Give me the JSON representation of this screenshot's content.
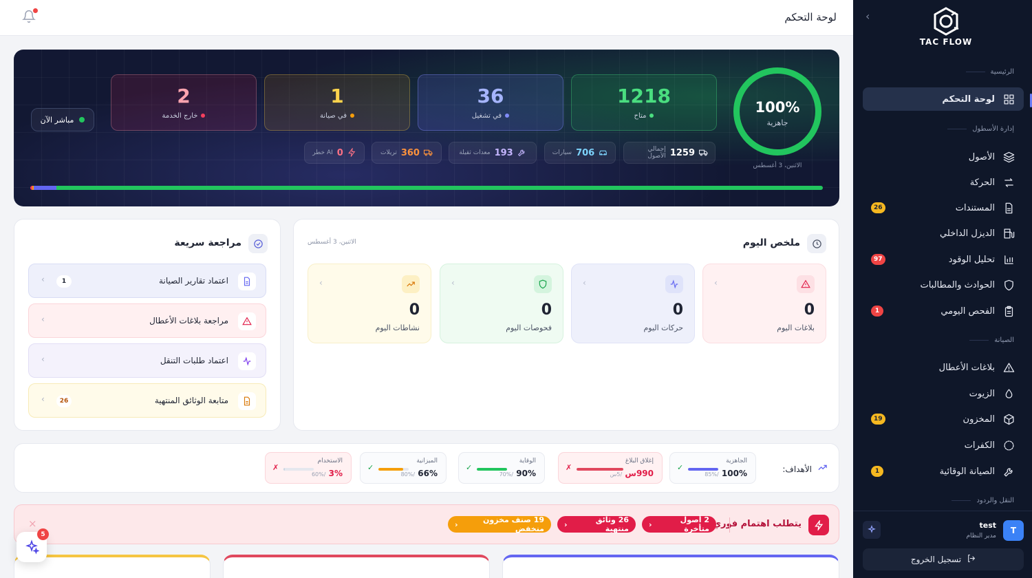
{
  "app": {
    "name": "TAC FLOW"
  },
  "topbar": {
    "title": "لوحة التحكم"
  },
  "sidebar": {
    "sections": {
      "main": "الرئيسية",
      "fleet": "إدارة الأسطول",
      "maintenance": "الصيانة",
      "transport": "النقل والردود"
    },
    "items": [
      {
        "label": "لوحة التحكم",
        "icon": "grid-icon",
        "active": true
      },
      {
        "label": "الأصول",
        "icon": "layers-icon"
      },
      {
        "label": "الحركة",
        "icon": "swap-icon"
      },
      {
        "label": "المستندات",
        "icon": "document-icon",
        "badge": "26"
      },
      {
        "label": "الديزل الداخلي",
        "icon": "fuel-icon"
      },
      {
        "label": "تحليل الوقود",
        "icon": "bar-chart-icon",
        "badge": "97"
      },
      {
        "label": "الحوادث والمطالبات",
        "icon": "shield-icon"
      },
      {
        "label": "الفحص اليومي",
        "icon": "clipboard-icon",
        "badge": "1"
      },
      {
        "label": "بلاغات الأعطال",
        "icon": "warning-icon"
      },
      {
        "label": "الزيوت",
        "icon": "droplet-icon"
      },
      {
        "label": "المخزون",
        "icon": "box-icon",
        "badge": "19"
      },
      {
        "label": "الكفرات",
        "icon": "tire-icon"
      },
      {
        "label": "الصيانة الوقائية",
        "icon": "wrench-icon",
        "badge": "1"
      }
    ],
    "user": {
      "initial": "T",
      "name": "test",
      "role": "مدير النظام"
    },
    "logout": "تسجيل الخروج"
  },
  "hero": {
    "readiness": {
      "value": "100%",
      "label": "جاهزية",
      "date": "الاثنين، 3 أغسطس"
    },
    "live": "مباشر الآن",
    "stats": [
      {
        "value": "1218",
        "label": "متاح",
        "color": "#4ade80"
      },
      {
        "value": "36",
        "label": "في تشغيل",
        "color": "#a5b4fc"
      },
      {
        "value": "1",
        "label": "في صيانة",
        "color": "#fcd34d"
      },
      {
        "value": "2",
        "label": "خارج الخدمة",
        "color": "#fda4af"
      }
    ],
    "chips": [
      {
        "value": "1259",
        "label": "إجمالي الأصول",
        "icon": "truck-icon"
      },
      {
        "value": "706",
        "label": "سيارات",
        "icon": "car-icon"
      },
      {
        "value": "193",
        "label": "معدات ثقيلة",
        "icon": "wrench-icon"
      },
      {
        "value": "360",
        "label": "تريلات",
        "icon": "trailer-icon"
      },
      {
        "value": "0",
        "label": "AI خطر",
        "icon": "bolt-icon"
      }
    ],
    "progress": {
      "available": 96.7,
      "operating": 2.9,
      "maintenance": 0.1,
      "out": 0.2
    }
  },
  "quick_review": {
    "title": "مراجعة سريعة",
    "items": [
      {
        "label": "اعتماد تقارير الصيانة",
        "badge": "1",
        "icon": "file-icon"
      },
      {
        "label": "مراجعة بلاغات الأعطال",
        "badge": "",
        "icon": "warning-icon"
      },
      {
        "label": "اعتماد طلبات التنقل",
        "badge": "",
        "icon": "activity-icon"
      },
      {
        "label": "متابعة الوثائق المنتهية",
        "badge": "26",
        "icon": "document-icon"
      }
    ]
  },
  "today": {
    "title": "ملخص اليوم",
    "date": "الاثنين، 3 أغسطس",
    "boxes": [
      {
        "value": "0",
        "label": "بلاغات اليوم",
        "icon": "warning-icon"
      },
      {
        "value": "0",
        "label": "حركات اليوم",
        "icon": "activity-icon"
      },
      {
        "value": "0",
        "label": "فحوصات اليوم",
        "icon": "shield-icon"
      },
      {
        "value": "0",
        "label": "نشاطات اليوم",
        "icon": "trending-up-icon"
      }
    ]
  },
  "goals": {
    "title": "الأهداف:",
    "items": [
      {
        "name": "الجاهزية",
        "value": "100%",
        "target": "/85%",
        "progress": 1.0,
        "ok": true
      },
      {
        "name": "إغلاق البلاغ",
        "value": "990س",
        "target": "/5س",
        "progress": 1.0,
        "ok": false
      },
      {
        "name": "الوقاية",
        "value": "90%",
        "target": "/70%",
        "progress": 1.0,
        "ok": true
      },
      {
        "name": "الميزانية",
        "value": "66%",
        "target": "/80%",
        "progress": 0.82,
        "ok": true
      },
      {
        "name": "الاستخدام",
        "value": "3%",
        "target": "/60%",
        "progress": 0.05,
        "ok": false
      }
    ],
    "ok_mark": "✓",
    "fail_mark": "✗"
  },
  "alert": {
    "title": "يتطلب اهتمام فوري",
    "pills": [
      {
        "label": "2 أصول متأخرة",
        "color": "#e11d48"
      },
      {
        "label": "26 وثائق منتهية",
        "color": "#e11d48"
      },
      {
        "label": "19 صنف مخزون منخفض",
        "color": "#f59e0b"
      }
    ],
    "close": "×"
  },
  "fab": {
    "badge": "5"
  }
}
